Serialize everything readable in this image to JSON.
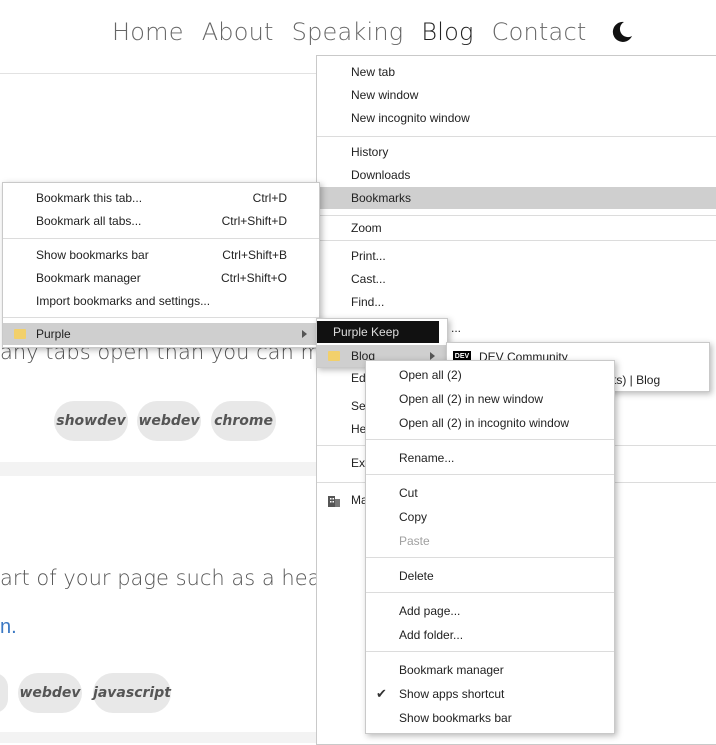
{
  "nav": {
    "items": [
      "Home",
      "About",
      "Speaking",
      "Blog",
      "Contact"
    ],
    "active": "Blog",
    "theme_icon": "moon-icon"
  },
  "page": {
    "para1": "any tabs open than you can m",
    "tags1": [
      "showdev",
      "webdev",
      "chrome"
    ],
    "para2": "art of your page such as a hea",
    "link_frag": "n.",
    "tags2": [
      "webdev",
      "javascript"
    ]
  },
  "chrome_menu": {
    "items": [
      {
        "label": "New tab"
      },
      {
        "label": "New window"
      },
      {
        "label": "New incognito window"
      },
      {
        "label": "History"
      },
      {
        "label": "Downloads"
      },
      {
        "label": "Bookmarks"
      },
      {
        "label": "Zoom"
      },
      {
        "label": "Print..."
      },
      {
        "label": "Cast..."
      },
      {
        "label": "Find..."
      },
      {
        "label": "Edi"
      },
      {
        "label": "Set"
      },
      {
        "label": "He"
      },
      {
        "label": "Exi"
      },
      {
        "label": "Ma"
      }
    ]
  },
  "bookmarks_menu": {
    "items": [
      {
        "label": "Bookmark this tab...",
        "shortcut": "Ctrl+D"
      },
      {
        "label": "Bookmark all tabs...",
        "shortcut": "Ctrl+Shift+D"
      },
      {
        "label": "Show bookmarks bar",
        "shortcut": "Ctrl+Shift+B"
      },
      {
        "label": "Bookmark manager",
        "shortcut": "Ctrl+Shift+O"
      },
      {
        "label": "Import bookmarks and settings..."
      },
      {
        "label": "Purple"
      }
    ]
  },
  "purple_menu": {
    "items": [
      {
        "label": "Purple Keep"
      },
      {
        "label": "Blog"
      }
    ],
    "trailing": "..."
  },
  "blog_menu": {
    "items": [
      {
        "label": "DEV Community",
        "icon_text": "DEV"
      },
      {
        "label": "hints) | Blog"
      }
    ]
  },
  "context_menu": {
    "items": [
      {
        "label": "Open all (2)"
      },
      {
        "label": "Open all (2) in new window"
      },
      {
        "label": "Open all (2) in incognito window"
      },
      {
        "label": "Rename..."
      },
      {
        "label": "Cut"
      },
      {
        "label": "Copy"
      },
      {
        "label": "Paste"
      },
      {
        "label": "Delete"
      },
      {
        "label": "Add page..."
      },
      {
        "label": "Add folder..."
      },
      {
        "label": "Bookmark manager"
      },
      {
        "label": "Show apps shortcut",
        "checked": true
      },
      {
        "label": "Show bookmarks bar"
      }
    ]
  },
  "colors": {
    "highlight": "#cfcfcf",
    "folder": "#f2d06b",
    "link": "#3b78c3"
  }
}
